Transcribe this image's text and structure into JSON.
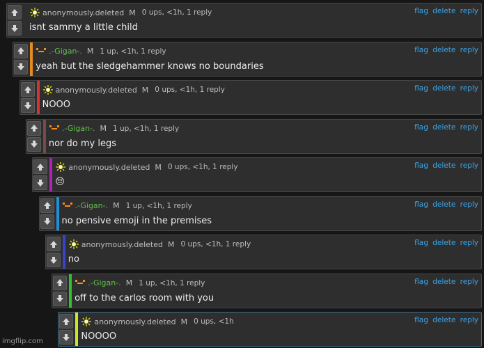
{
  "comments": [
    {
      "user": "anonymously.deleted",
      "avatar": "sun-icon",
      "user_color": "#bdbdbd",
      "mod": "M",
      "meta": "0 ups, <1h, 1 reply",
      "text": "isnt sammy a little child",
      "bar_color": "#2e2e2e"
    },
    {
      "user": ".-Gigan-.",
      "avatar": "gigan-face-icon",
      "user_color": "#5fc24a",
      "mod": "M",
      "meta": "1 up, <1h, 1 reply",
      "text": "yeah but the sledgehammer knows no boundaries",
      "bar_color": "#e38b1c"
    },
    {
      "user": "anonymously.deleted",
      "avatar": "sun-icon",
      "user_color": "#bdbdbd",
      "mod": "M",
      "meta": "0 ups, <1h, 1 reply",
      "text": "NOOO",
      "bar_color": "#d63333"
    },
    {
      "user": ".-Gigan-.",
      "avatar": "gigan-face-icon",
      "user_color": "#5fc24a",
      "mod": "M",
      "meta": "1 up, <1h, 1 reply",
      "text": "nor do my legs",
      "bar_color": "#7a4a4a"
    },
    {
      "user": "anonymously.deleted",
      "avatar": "sun-icon",
      "user_color": "#bdbdbd",
      "mod": "M",
      "meta": "0 ups, <1h, 1 reply",
      "text": "😔",
      "bar_color": "#b023b8"
    },
    {
      "user": ".-Gigan-.",
      "avatar": "gigan-face-icon",
      "user_color": "#5fc24a",
      "mod": "M",
      "meta": "1 up, <1h, 1 reply",
      "text": "no pensive emoji in the premises",
      "bar_color": "#1f8fd6"
    },
    {
      "user": "anonymously.deleted",
      "avatar": "sun-icon",
      "user_color": "#bdbdbd",
      "mod": "M",
      "meta": "0 ups, <1h, 1 reply",
      "text": "no",
      "bar_color": "#3a44c8"
    },
    {
      "user": ".-Gigan-.",
      "avatar": "gigan-face-icon",
      "user_color": "#5fc24a",
      "mod": "M",
      "meta": "1 up, <1h, 1 reply",
      "text": "off to the carlos room with you",
      "bar_color": "#2ec22e"
    },
    {
      "user": "anonymously.deleted",
      "avatar": "sun-icon",
      "user_color": "#bdbdbd",
      "mod": "M",
      "meta": "0 ups, <1h",
      "text": "NOOOO",
      "bar_color": "#c8e62a"
    }
  ],
  "actions": {
    "flag": "flag",
    "delete": "delete",
    "reply": "reply"
  },
  "watermark": "imgflip.com"
}
